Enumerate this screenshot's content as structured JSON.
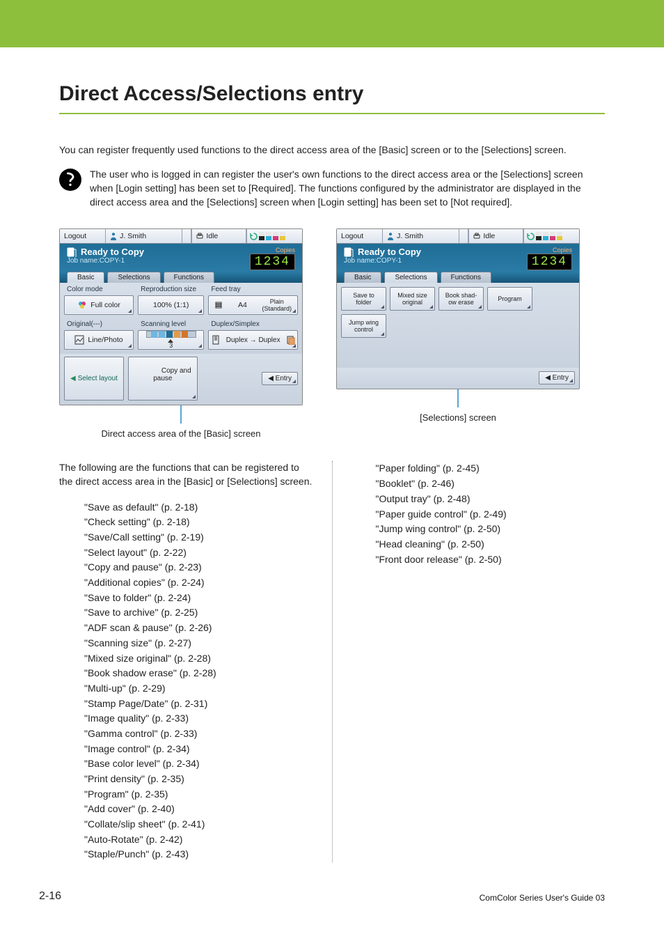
{
  "page_title": "Direct Access/Selections entry",
  "intro": "You can register frequently used functions to the direct access area of the [Basic] screen or to the [Selections] screen.",
  "note": "The user who is logged in can register the user's own functions to the direct access area or the [Selections] screen when [Login setting] has been set to [Required]. The functions configured by the administrator are displayed in the direct access area and the [Selections] screen when [Login setting] has been set to [Not required].",
  "shot_common": {
    "logout": "Logout",
    "user": "J. Smith",
    "idle": "Idle",
    "ready": "Ready to Copy",
    "jobname": "Job name:COPY-1",
    "copies_label": "Copies",
    "copies_value": "1234",
    "tabs": {
      "basic": "Basic",
      "selections": "Selections",
      "functions": "Functions"
    },
    "entry": "◀ Entry"
  },
  "shot_basic": {
    "groups": {
      "color_mode": {
        "label": "Color mode",
        "value": "Full color"
      },
      "repro": {
        "label": "Reproduction size",
        "value": "100% (1:1)"
      },
      "feed": {
        "label": "Feed tray",
        "value1": "A4",
        "value2": "Plain\n(Standard)"
      },
      "original": {
        "label": "Original(---)",
        "value": "Line/Photo"
      },
      "scan": {
        "label": "Scanning level",
        "value": "3"
      },
      "duplex": {
        "label": "Duplex/Simplex",
        "value": "Duplex → Duplex"
      }
    },
    "bottom": {
      "select_layout": "Select layout",
      "copy_pause": "Copy and\npause"
    },
    "caption": "Direct access area of the [Basic] screen",
    "lead": "The following are the functions that can be registered to the direct access area in the [Basic] or [Selections] screen."
  },
  "shot_sel": {
    "buttons": [
      "Save to\nfolder",
      "Mixed size\noriginal",
      "Book shad-\now erase",
      "Program",
      "Jump wing\ncontrol"
    ],
    "caption": "[Selections] screen"
  },
  "func_list_left": [
    "\"Save as default\" (p. 2-18)",
    "\"Check setting\" (p. 2-18)",
    "\"Save/Call setting\" (p. 2-19)",
    "\"Select layout\" (p. 2-22)",
    "\"Copy and pause\" (p. 2-23)",
    "\"Additional copies\" (p. 2-24)",
    "\"Save to folder\" (p. 2-24)",
    "\"Save to archive\" (p. 2-25)",
    "\"ADF scan & pause\" (p. 2-26)",
    "\"Scanning size\" (p. 2-27)",
    "\"Mixed size original\" (p. 2-28)",
    "\"Book shadow erase\" (p. 2-28)",
    "\"Multi-up\" (p. 2-29)",
    "\"Stamp Page/Date\" (p. 2-31)",
    "\"Image quality\" (p. 2-33)",
    "\"Gamma control\" (p. 2-33)",
    "\"Image control\" (p. 2-34)",
    "\"Base color level\" (p. 2-34)",
    "\"Print density\" (p. 2-35)",
    "\"Program\" (p. 2-35)",
    "\"Add cover\" (p. 2-40)",
    "\"Collate/slip sheet\" (p. 2-41)",
    "\"Auto-Rotate\" (p. 2-42)",
    "\"Staple/Punch\" (p. 2-43)"
  ],
  "func_list_right": [
    "\"Paper folding\" (p. 2-45)",
    "\"Booklet\" (p. 2-46)",
    "\"Output tray\" (p. 2-48)",
    "\"Paper guide control\" (p. 2-49)",
    "\"Jump wing control\" (p. 2-50)",
    "\"Head cleaning\" (p. 2-50)",
    "\"Front door release\" (p. 2-50)"
  ],
  "footer": {
    "pagenum": "2-16",
    "guide": "ComColor Series User's Guide 03"
  }
}
